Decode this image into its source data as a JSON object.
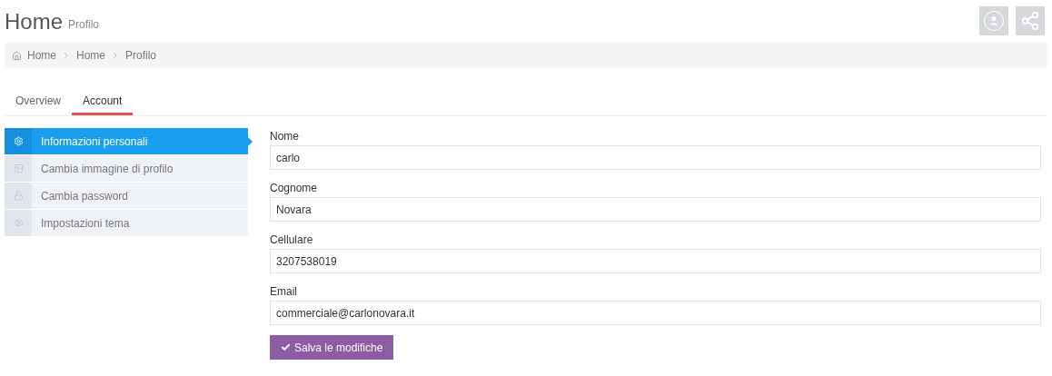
{
  "header": {
    "title": "Home",
    "subtitle": "Profilo"
  },
  "breadcrumb": [
    {
      "label": "Home",
      "kind": "home"
    },
    {
      "label": "Home",
      "kind": "page"
    },
    {
      "label": "Profilo",
      "kind": "page"
    }
  ],
  "tabs": [
    {
      "label": "Overview",
      "selected": false
    },
    {
      "label": "Account",
      "selected": true
    }
  ],
  "sidebar": {
    "items": [
      {
        "label": "Informazioni personali",
        "kind": "settings",
        "selected": true
      },
      {
        "label": "Cambia immagine di profilo",
        "kind": "image",
        "selected": false
      },
      {
        "label": "Cambia password",
        "kind": "lock",
        "selected": false
      },
      {
        "label": "Impostazioni tema",
        "kind": "eye",
        "selected": false
      }
    ]
  },
  "form": {
    "fields": [
      {
        "label": "Nome",
        "value": "carlo"
      },
      {
        "label": "Cognome",
        "value": "Novara"
      },
      {
        "label": "Cellulare",
        "value": "3207538019"
      },
      {
        "label": "Email",
        "value": "commerciale@carlonovara.it"
      }
    ],
    "submit": "Salva le modifiche"
  }
}
